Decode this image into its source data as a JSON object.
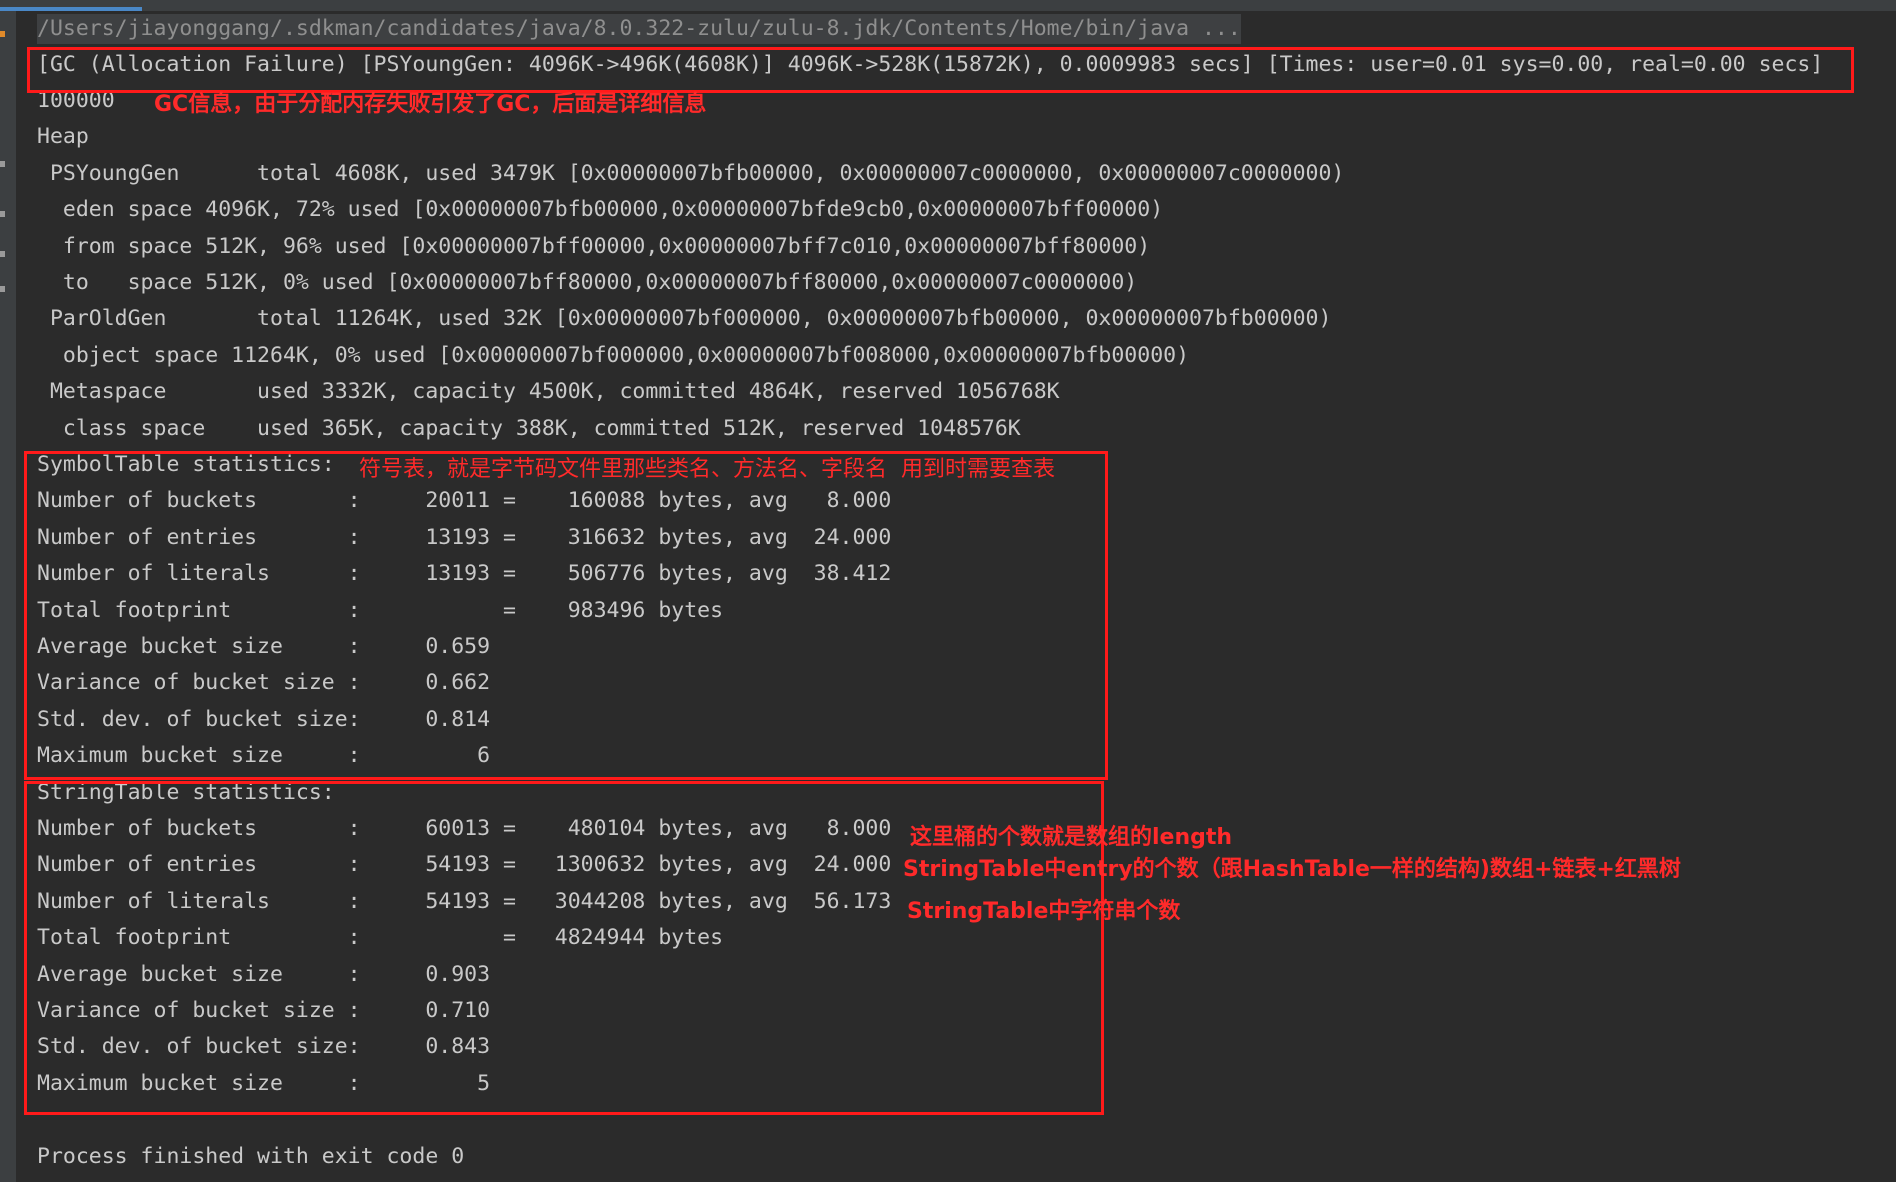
{
  "console": {
    "command": "/Users/jiayonggang/.sdkman/candidates/java/8.0.322-zulu/zulu-8.jdk/Contents/Home/bin/java ...",
    "lines": [
      "[GC (Allocation Failure) [PSYoungGen: 4096K->496K(4608K)] 4096K->528K(15872K), 0.0009983 secs] [Times: user=0.01 sys=0.00, real=0.00 secs]",
      "100000",
      "Heap",
      " PSYoungGen      total 4608K, used 3479K [0x00000007bfb00000, 0x00000007c0000000, 0x00000007c0000000)",
      "  eden space 4096K, 72% used [0x00000007bfb00000,0x00000007bfde9cb0,0x00000007bff00000)",
      "  from space 512K, 96% used [0x00000007bff00000,0x00000007bff7c010,0x00000007bff80000)",
      "  to   space 512K, 0% used [0x00000007bff80000,0x00000007bff80000,0x00000007c0000000)",
      " ParOldGen       total 11264K, used 32K [0x00000007bf000000, 0x00000007bfb00000, 0x00000007bfb00000)",
      "  object space 11264K, 0% used [0x00000007bf000000,0x00000007bf008000,0x00000007bfb00000)",
      " Metaspace       used 3332K, capacity 4500K, committed 4864K, reserved 1056768K",
      "  class space    used 365K, capacity 388K, committed 512K, reserved 1048576K",
      "SymbolTable statistics:",
      "Number of buckets       :     20011 =    160088 bytes, avg   8.000",
      "Number of entries       :     13193 =    316632 bytes, avg  24.000",
      "Number of literals      :     13193 =    506776 bytes, avg  38.412",
      "Total footprint         :           =    983496 bytes",
      "Average bucket size     :     0.659",
      "Variance of bucket size :     0.662",
      "Std. dev. of bucket size:     0.814",
      "Maximum bucket size     :         6",
      "StringTable statistics:",
      "Number of buckets       :     60013 =    480104 bytes, avg   8.000",
      "Number of entries       :     54193 =   1300632 bytes, avg  24.000",
      "Number of literals      :     54193 =   3044208 bytes, avg  56.173",
      "Total footprint         :           =   4824944 bytes",
      "Average bucket size     :     0.903",
      "Variance of bucket size :     0.710",
      "Std. dev. of bucket size:     0.843",
      "Maximum bucket size     :         5",
      "",
      "Process finished with exit code 0"
    ]
  },
  "annotations": {
    "gc": "GC信息，由于分配内存失败引发了GC，后面是详细信息",
    "symbol_table": "符号表，就是字节码文件里那些类名、方法名、字段名  用到时需要查表",
    "buckets": "这里桶的个数就是数组的length",
    "entries": "StringTable中entry的个数（跟HashTable一样的结构)数组+链表+红黑树",
    "literals": "StringTable中字符串个数"
  },
  "colors": {
    "background": "#2b2b2b",
    "text": "#c9c9c9",
    "annotation": "#ff2a2a",
    "highlight_box": "#ff1a1a"
  }
}
